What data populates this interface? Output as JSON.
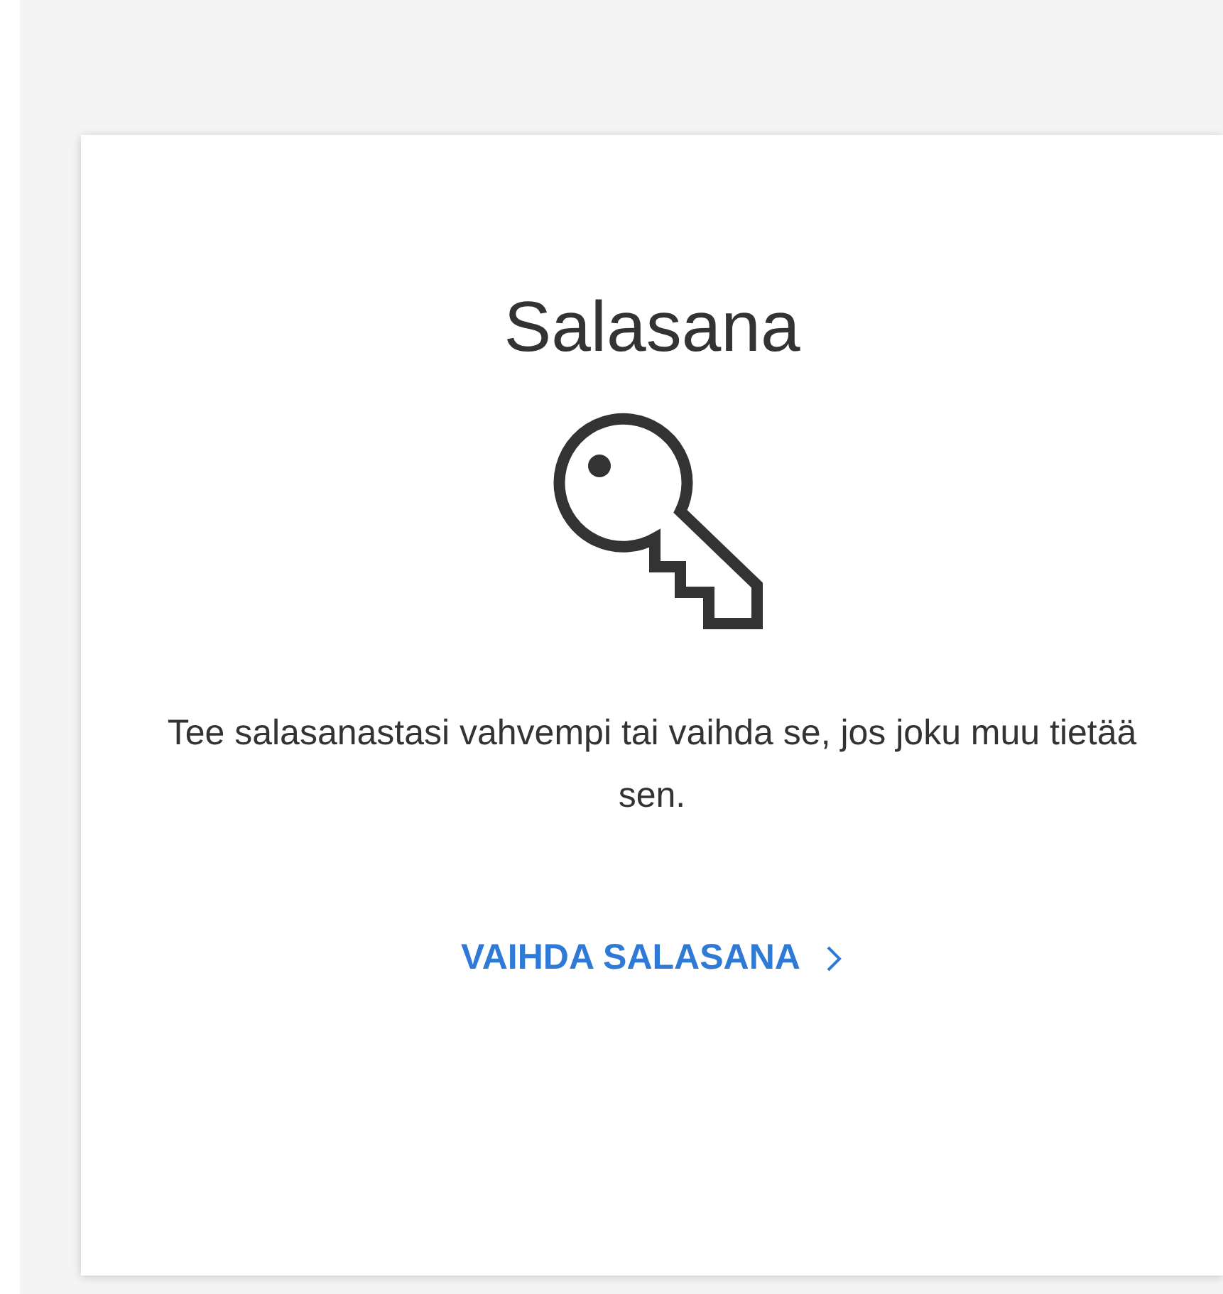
{
  "card": {
    "title": "Salasana",
    "description": "Tee salasanastasi vahvempi tai vaihda se, jos joku muu tietää sen.",
    "link": {
      "label": "VAIHDA SALASANA"
    }
  }
}
